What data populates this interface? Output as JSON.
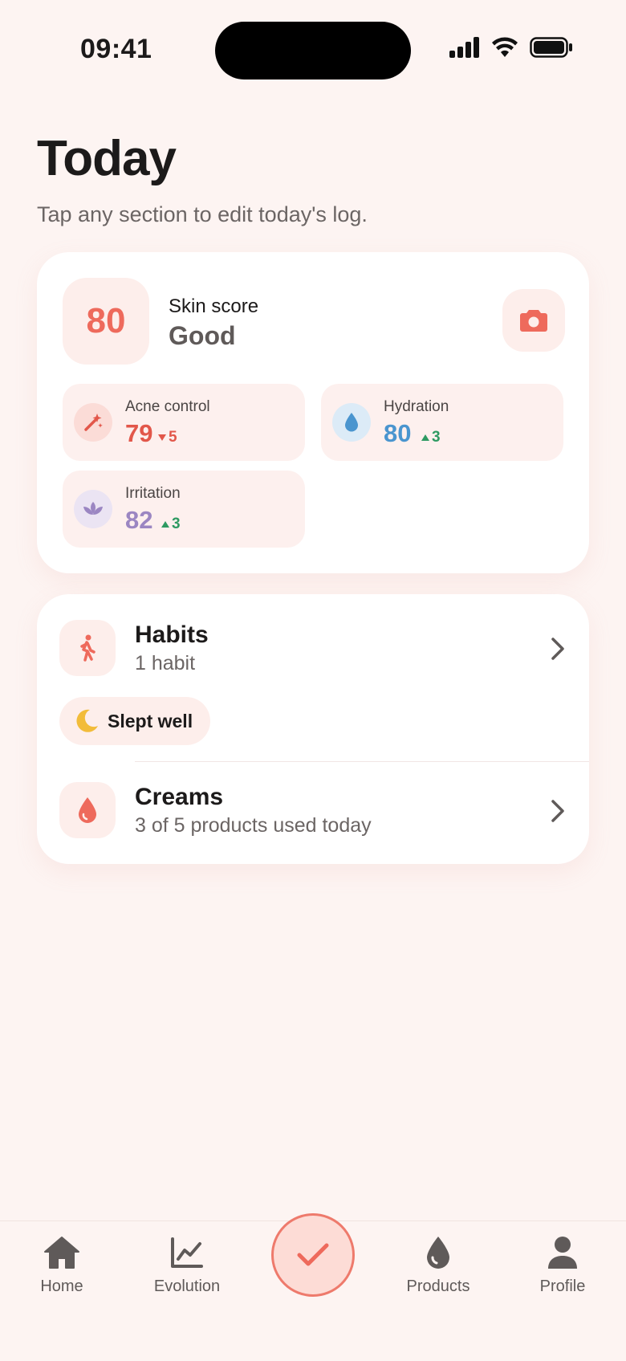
{
  "status_bar": {
    "time": "09:41"
  },
  "header": {
    "title": "Today",
    "subtitle": "Tap any section to edit today's log."
  },
  "score_card": {
    "score": "80",
    "label": "Skin score",
    "rating": "Good",
    "metrics": [
      {
        "label": "Acne control",
        "value": "79",
        "delta": "5",
        "direction": "down",
        "color": "#e2574a"
      },
      {
        "label": "Hydration",
        "value": "80",
        "delta": "3",
        "direction": "up",
        "color": "#4a95cf"
      },
      {
        "label": "Irritation",
        "value": "82",
        "delta": "3",
        "direction": "up",
        "color": "#9b86c2"
      }
    ]
  },
  "habits": {
    "title": "Habits",
    "subtitle": "1 habit",
    "chips": [
      {
        "label": "Slept well",
        "icon": "moon-icon"
      }
    ]
  },
  "creams": {
    "title": "Creams",
    "subtitle": "3 of 5 products used today"
  },
  "tabs": [
    {
      "label": "Home",
      "icon": "home-icon"
    },
    {
      "label": "Evolution",
      "icon": "chart-line-icon"
    },
    {
      "label": "Products",
      "icon": "drop-icon"
    },
    {
      "label": "Profile",
      "icon": "person-icon"
    }
  ],
  "colors": {
    "accent": "#ee6a5c",
    "background": "#fdf4f2",
    "positive": "#2e9a62",
    "negative": "#e2574a"
  }
}
